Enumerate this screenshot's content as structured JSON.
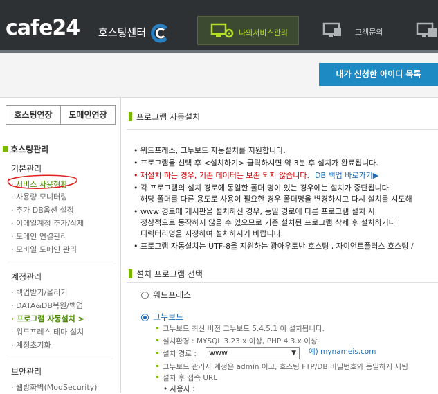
{
  "header": {
    "logo_text": "cafe24",
    "logo_sub": "호스팅센터",
    "nav": [
      {
        "label": "나의서비스관리",
        "icon": "monitor-gear-icon",
        "active": true
      },
      {
        "label": "고객문의",
        "icon": "support-monitor-icon",
        "active": false
      },
      {
        "label": "",
        "icon": "admin-monitor-icon",
        "active": false
      }
    ]
  },
  "toolbar": {
    "my_ids_button": "내가 신청한 아이디 목록"
  },
  "sidebar": {
    "tabs": [
      "호스팅연장",
      "도메인연장"
    ],
    "section_title": "호스팅관리",
    "groups": [
      {
        "title": "기본관리",
        "items": [
          "서비스 사용현황",
          "사용량 모니터링",
          "추가 DB옵션 설정",
          "이메일계정 추가/삭제",
          "도메인 연결관리",
          "모바일 도메인 관리"
        ]
      },
      {
        "title": "계정관리",
        "items": [
          "백업받기/올리기",
          "DATA&DB복원/백업",
          "프로그램 자동설치 >",
          "워드프레스 테마 설치",
          "계정초기화"
        ]
      },
      {
        "title": "보안관리",
        "items": [
          "웹방화벽(ModSecurity)"
        ]
      }
    ]
  },
  "main": {
    "title": "프로그램 자동설치",
    "notes": [
      "워드프레스, 그누보드 자동설치를 지원합니다.",
      "프로그램을 선택 후 <설치하기> 클릭하시면 약 3분 후 설치가 완료됩니다.",
      "재설치 하는 경우, 기존 데이터는 보존 되지 않습니다.",
      "DB 백업 바로가기▶",
      "각 프로그램의 설치 경로에 동일한 폴더 명이 있는 경우에는 설치가 중단됩니다.",
      "해당 폴더를 다른 용도로 사용이 필요한 경우 폴더명을 변경하시고 다시 설치를 시도해",
      "www 경로에 게시판을 설치하신 경우, 동일 경로에 다른 프로그램 설치 시",
      "정상적으로 동작하지 않을 수 있으므로 기존 설치된 프로그램 삭제 후 설치하거나",
      "디렉터리명을 지정하여 설치하시기 바랍니다.",
      "프로그램 자동설치는 UTF-8을 지원하는 광아우토반 호스팅 , 자이언트플러스 호스팅 /"
    ],
    "select_title": "설치 프로그램 선택",
    "programs": [
      {
        "label": "워드프레스",
        "selected": false
      },
      {
        "label": "그누보드",
        "selected": true
      }
    ],
    "details": [
      "그누보드 최신 버전 그누보드 5.4.5.1 이 설치됩니다.",
      "설치환경 : MYSQL 3.23.x 이상, PHP 4.3.x 이상",
      "설치 경로 :",
      "그누보드 관리자 계정은 admin 이고, 호스팅 FTP/DB 비밀번호와 동일하게 세팅",
      "설치 후 접속 URL",
      "사용자 :"
    ],
    "path_select": "www",
    "path_example": "예) mynameis.com"
  },
  "colors": {
    "header_bg": "#2d3134",
    "accent_green": "#7ab800",
    "button_blue": "#1e8ac4",
    "warning_red": "#d10000"
  }
}
